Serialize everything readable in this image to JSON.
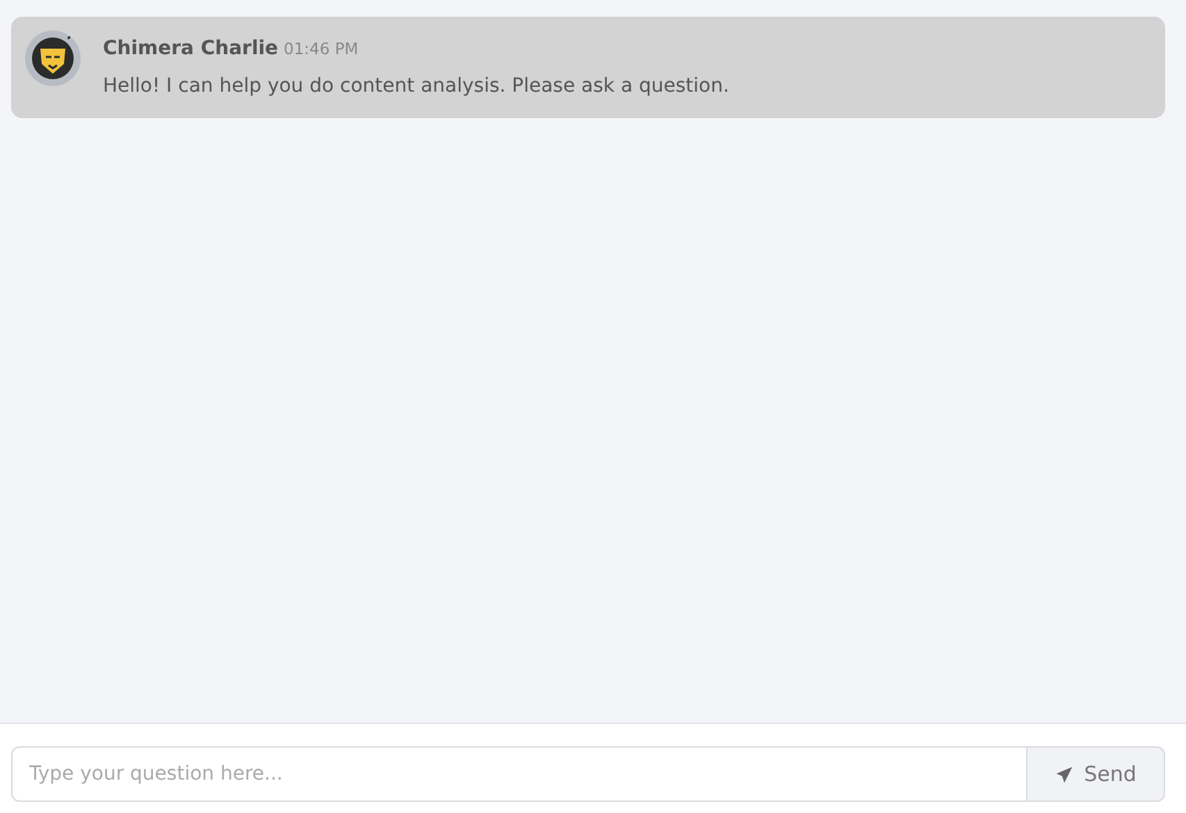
{
  "messages": [
    {
      "sender": "Chimera Charlie",
      "time": "01:46 PM",
      "text": "Hello! I can help you do content analysis. Please ask a question."
    }
  ],
  "composer": {
    "placeholder": "Type your question here...",
    "button": "Send"
  }
}
